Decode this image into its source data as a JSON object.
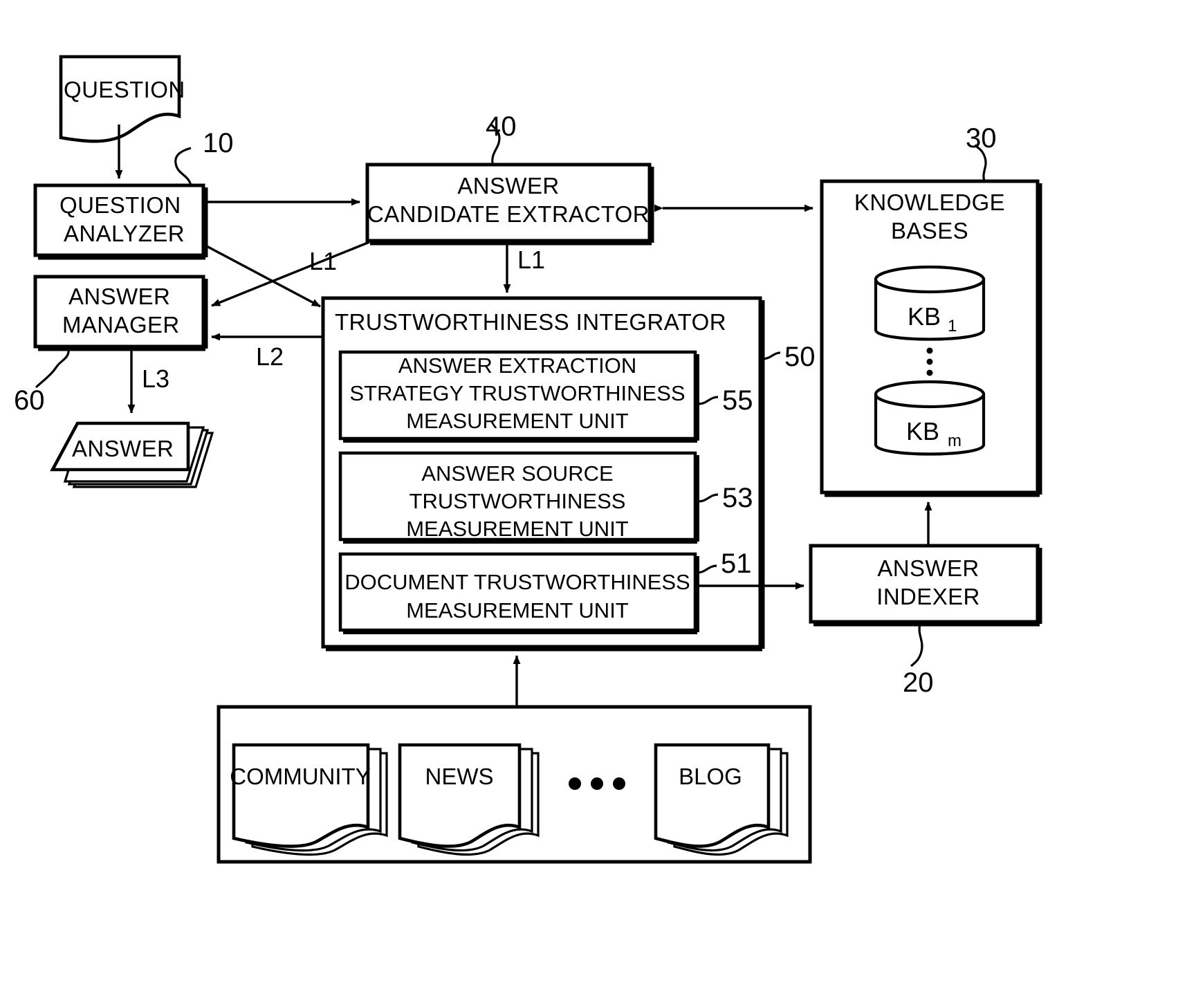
{
  "figure": {
    "title": "Question answering system block diagram",
    "type": "patent-block-diagram"
  },
  "nodes": {
    "question_doc": {
      "label": "QUESTION"
    },
    "question_analyzer": {
      "label_line1": "QUESTION",
      "label_line2": "ANALYZER",
      "ref": "10"
    },
    "answer_manager": {
      "label_line1": "ANSWER",
      "label_line2": "MANAGER",
      "ref": "60"
    },
    "answer_doc": {
      "label": "ANSWER"
    },
    "answer_candidate_extractor": {
      "label_line1": "ANSWER",
      "label_line2": "CANDIDATE EXTRACTOR",
      "ref": "40"
    },
    "trustworthiness_integrator": {
      "label": "TRUSTWORTHINESS INTEGRATOR",
      "ref": "50"
    },
    "unit_55": {
      "label_line1": "ANSWER EXTRACTION",
      "label_line2": "STRATEGY TRUSTWORTHINESS",
      "label_line3": "MEASUREMENT UNIT",
      "ref": "55"
    },
    "unit_53": {
      "label_line1": "ANSWER SOURCE",
      "label_line2": "TRUSTWORTHINESS",
      "label_line3": "MEASUREMENT UNIT",
      "ref": "53"
    },
    "unit_51": {
      "label_line1": "DOCUMENT TRUSTWORTHINESS",
      "label_line2": "MEASUREMENT UNIT",
      "ref": "51"
    },
    "knowledge_bases": {
      "label_line1": "KNOWLEDGE",
      "label_line2": "BASES",
      "ref": "30",
      "db_first": "KB",
      "db_first_sub": "1",
      "db_last": "KB",
      "db_last_sub": "m",
      "ellipsis": "⋮"
    },
    "answer_indexer": {
      "label_line1": "ANSWER",
      "label_line2": "INDEXER",
      "ref": "20"
    },
    "sources": {
      "items": [
        {
          "label": "COMMUNITY"
        },
        {
          "label": "NEWS"
        },
        {
          "label": "BLOG"
        }
      ],
      "ellipsis": "• • •"
    }
  },
  "edges": {
    "l1_analyzer_to_integrator": "L1",
    "l1_extractor_to_integrator": "L1",
    "l2_integrator_to_manager": "L2",
    "l3_manager_to_answer": "L3"
  },
  "colors": {
    "line": "#000000",
    "background": "#ffffff"
  }
}
